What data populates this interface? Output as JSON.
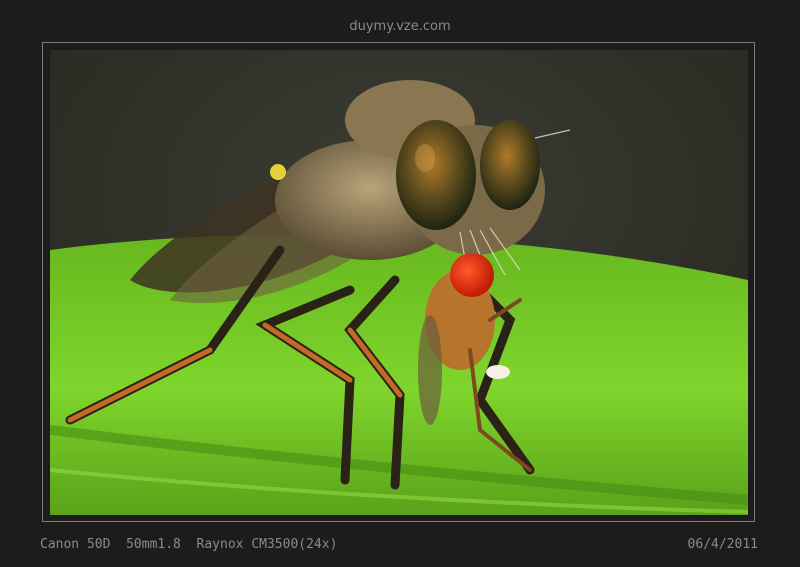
{
  "watermark": "duymy.vze.com",
  "photo": {
    "subject": "robber-fly-with-prey-photo",
    "background_color": "#2d2f27",
    "leaf_color": "#74cc26"
  },
  "caption": {
    "camera": "Canon 50D  50mm1.8  Raynox CM3500(24x)",
    "date": "06/4/2011"
  }
}
